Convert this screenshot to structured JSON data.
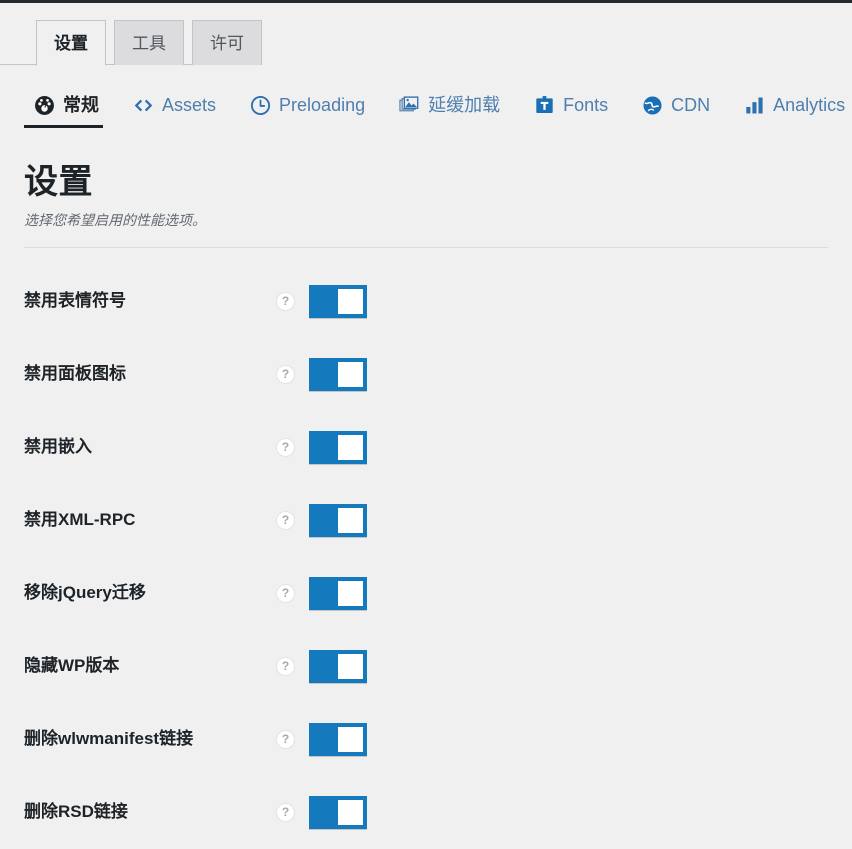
{
  "window": {
    "admin_bar_color": "#23282d",
    "background_color": "#f0f0f1",
    "accent_color": "#1579bd",
    "link_color": "#4f7fad"
  },
  "tabs": [
    {
      "label": "设置",
      "active": true
    },
    {
      "label": "工具",
      "active": false
    },
    {
      "label": "许可",
      "active": false
    }
  ],
  "subnav": [
    {
      "label": "常规",
      "icon": "dashboard-icon",
      "active": true
    },
    {
      "label": "Assets",
      "icon": "code-icon",
      "active": false
    },
    {
      "label": "Preloading",
      "icon": "clock-icon",
      "active": false
    },
    {
      "label": "延缓加载",
      "icon": "images-icon",
      "active": false
    },
    {
      "label": "Fonts",
      "icon": "fonts-icon",
      "active": false
    },
    {
      "label": "CDN",
      "icon": "globe-icon",
      "active": false
    },
    {
      "label": "Analytics",
      "icon": "bar-chart-icon",
      "active": false
    }
  ],
  "page": {
    "title": "设置",
    "subtitle": "选择您希望启用的性能选项。"
  },
  "settings": [
    {
      "label": "禁用表情符号",
      "help": "?",
      "enabled": true
    },
    {
      "label": "禁用面板图标",
      "help": "?",
      "enabled": true
    },
    {
      "label": "禁用嵌入",
      "help": "?",
      "enabled": true
    },
    {
      "label": "禁用XML-RPC",
      "help": "?",
      "enabled": true
    },
    {
      "label": "移除jQuery迁移",
      "help": "?",
      "enabled": true
    },
    {
      "label": "隐藏WP版本",
      "help": "?",
      "enabled": true
    },
    {
      "label": "删除wlwmanifest链接",
      "help": "?",
      "enabled": true
    },
    {
      "label": "删除RSD链接",
      "help": "?",
      "enabled": true
    }
  ]
}
